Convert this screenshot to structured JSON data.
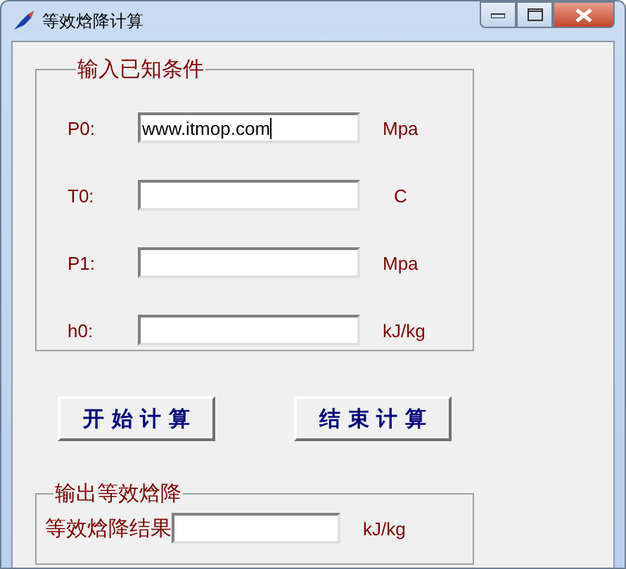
{
  "window": {
    "title": "等效焓降计算"
  },
  "input_group": {
    "title": "输入已知条件",
    "rows": [
      {
        "label": "P0:",
        "value": "www.itmop.com",
        "unit": "Mpa"
      },
      {
        "label": "T0:",
        "value": "",
        "unit": "C"
      },
      {
        "label": "P1:",
        "value": "",
        "unit": "Mpa"
      },
      {
        "label": "h0:",
        "value": "",
        "unit": "kJ/kg"
      }
    ]
  },
  "buttons": [
    "开 始 计 算",
    "结 束 计 算"
  ],
  "output_group": {
    "title": "输出等效焓降",
    "label": "等效焓降结果",
    "unit": "kJ/kg"
  }
}
